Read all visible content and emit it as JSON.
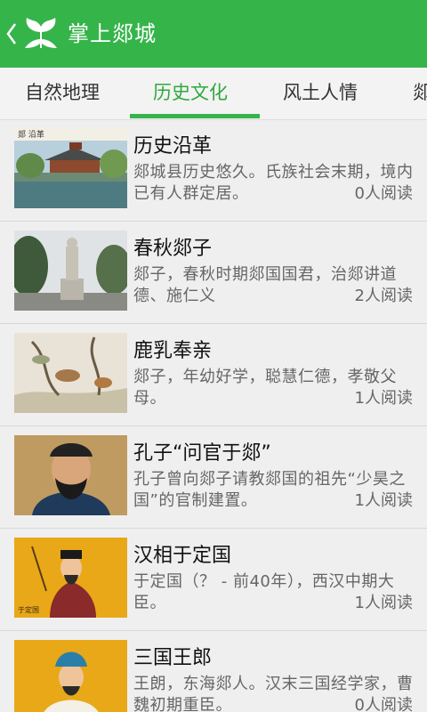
{
  "header": {
    "title": "掌上郯城"
  },
  "tabs": [
    {
      "label": "自然地理",
      "active": false
    },
    {
      "label": "历史文化",
      "active": true
    },
    {
      "label": "风土人情",
      "active": false
    },
    {
      "label": "郯",
      "active": false
    }
  ],
  "articles": [
    {
      "title": "历史沿革",
      "desc": "郯城县历史悠久。氏族社会末期，境内已有人群定居。",
      "reads": "0人阅读",
      "thumb_caption": "郯 沿革"
    },
    {
      "title": "春秋郯子",
      "desc": "郯子，春秋时期郯国国君，治郯讲道德、施仁义",
      "reads": "2人阅读"
    },
    {
      "title": "鹿乳奉亲",
      "desc": "郯子，年幼好学，聪慧仁德，孝敬父母。",
      "reads": "1人阅读"
    },
    {
      "title": "孔子“问官于郯”",
      "desc": "孔子曾向郯子请教郯国的祖先“少昊之国”的官制建置。",
      "reads": "1人阅读"
    },
    {
      "title": "汉相于定国",
      "desc": "于定国（？ - 前40年），西汉中期大臣。",
      "reads": "1人阅读",
      "thumb_caption": "于定国"
    },
    {
      "title": "三国王郎",
      "desc": "王朗，东海郯人。汉末三国经学家，曹魏初期重臣。",
      "reads": "0人阅读"
    }
  ],
  "colors": {
    "accent": "#35b44a",
    "background": "#efefef"
  }
}
